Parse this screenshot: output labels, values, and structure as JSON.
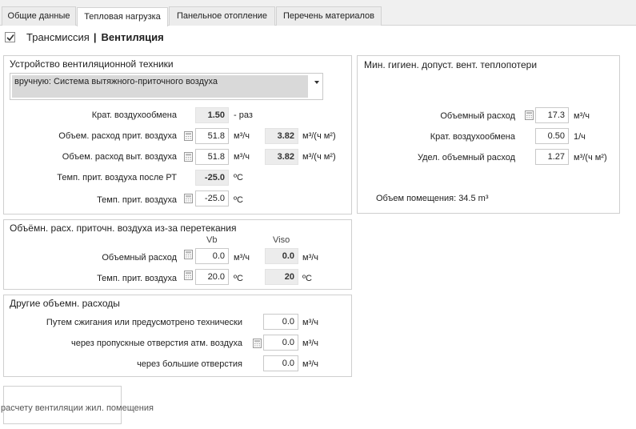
{
  "tabs": [
    {
      "label": "Общие данные",
      "active": false
    },
    {
      "label": "Тепловая нагрузка",
      "active": true
    },
    {
      "label": "Панельное отопление",
      "active": false
    },
    {
      "label": "Перечень материалов",
      "active": false
    }
  ],
  "subtabs": {
    "checked": true,
    "transmission": "Трансмиссия",
    "separator": "|",
    "ventilation": "Вентиляция"
  },
  "device": {
    "title": "Устройство вентиляционной техники",
    "select_value": "вручную: Система вытяжного-приточного воздуха",
    "air_exchange": {
      "label": "Крат. воздухообмена",
      "value": "1.50",
      "unit": "- раз"
    },
    "supply_flow": {
      "label": "Объем. расход прит. воздуха",
      "value": "51.8",
      "unit": "м³/ч",
      "spec": "3.82",
      "spec_unit": "м³/(ч м²)"
    },
    "exhaust_flow": {
      "label": "Объем. расход выт. воздуха",
      "value": "51.8",
      "unit": "м³/ч",
      "spec": "3.82",
      "spec_unit": "м³/(ч м²)"
    },
    "temp_after_rt": {
      "label": "Темп. прит. воздуха после РТ",
      "value": "-25.0",
      "unit": "ºC"
    },
    "supply_temp": {
      "label": "Темп. прит. воздуха",
      "value": "-25.0",
      "unit": "ºC"
    }
  },
  "min_hygiene": {
    "title": "Мин. гигиен. допуст. вент. теплопотери",
    "volume_flow": {
      "label": "Объемный расход",
      "value": "17.3",
      "unit": "м³/ч"
    },
    "air_exchange": {
      "label": "Крат. воздухообмена",
      "value": "0.50",
      "unit": "1/ч"
    },
    "specific_flow": {
      "label": "Удел. объемный расход",
      "value": "1.27",
      "unit": "м³/(ч м²)"
    },
    "room_volume": "Объем помещения: 34.5 m³"
  },
  "overflow": {
    "title": "Объёмн. расх. приточн. воздуха из-за перетекания",
    "col_vb": "Vb",
    "col_viso": "Viso",
    "volume_flow": {
      "label": "Объемный расход",
      "value": "0.0",
      "unit": "м³/ч",
      "viso": "0.0",
      "viso_unit": "м³/ч"
    },
    "supply_temp": {
      "label": "Темп. прит. воздуха",
      "value": "20.0",
      "unit": "ºC",
      "viso": "20",
      "viso_unit": "ºC"
    }
  },
  "other": {
    "title": "Другие объемн. расходы",
    "combustion": {
      "label": "Путем сжигания или предусмотрено технически",
      "value": "0.0",
      "unit": "м³/ч"
    },
    "atm_openings": {
      "label": "через пропускные отверстия атм. воздуха",
      "value": "0.0",
      "unit": "м³/ч"
    },
    "large_openings": {
      "label": "через большие отверстия",
      "value": "0.0",
      "unit": "м³/ч"
    }
  },
  "bottom_button": {
    "label": "расчету вентиляции жил. помещения"
  }
}
